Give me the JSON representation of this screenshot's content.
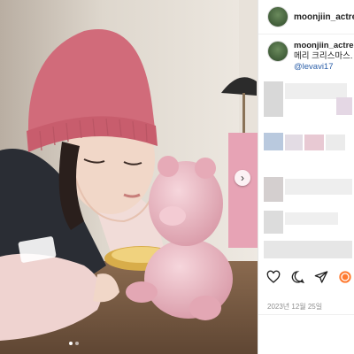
{
  "post": {
    "username": "moonjiin_actress",
    "caption_user": "moonjiin_actress",
    "caption_text": "메리 크리스마스.",
    "mention": "@levavi17",
    "date": "2023년 12월 25일"
  },
  "icons": {
    "like": "heart-icon",
    "comment": "comment-icon",
    "share": "send-icon",
    "next": "chevron-right-icon"
  },
  "colors": {
    "hat": "#d8707c",
    "bear": "#e9b7c1",
    "mention": "#2a5ea8"
  }
}
